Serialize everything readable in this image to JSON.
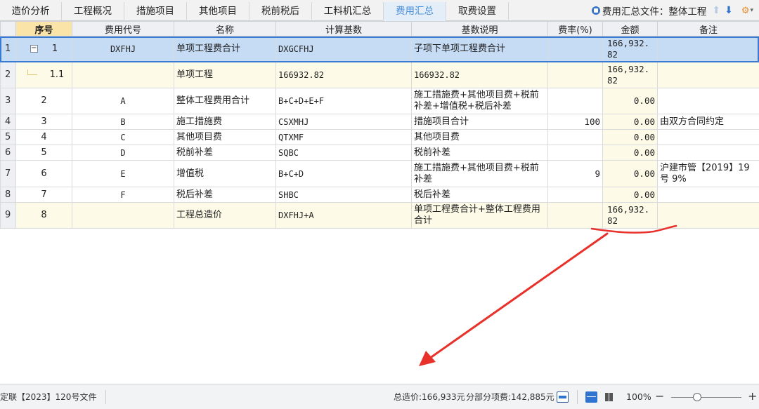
{
  "tabs": [
    {
      "label": "造价分析",
      "active": false
    },
    {
      "label": "工程概况",
      "active": false
    },
    {
      "label": "措施项目",
      "active": false
    },
    {
      "label": "其他项目",
      "active": false
    },
    {
      "label": "税前税后",
      "active": false
    },
    {
      "label": "工料机汇总",
      "active": false
    },
    {
      "label": "费用汇总",
      "active": true
    },
    {
      "label": "取费设置",
      "active": false
    }
  ],
  "header_right": {
    "file_label": "费用汇总文件：整体工程",
    "icons": [
      "file-summary-icon",
      "arrow-up-icon",
      "arrow-down-icon",
      "toolbar-settings-icon"
    ]
  },
  "columns": [
    "序号",
    "费用代号",
    "名称",
    "计算基数",
    "基数说明",
    "费率(%)",
    "金额",
    "备注"
  ],
  "rows": [
    {
      "rownum": "1",
      "seq": "1",
      "code": "DXFHJ",
      "name": "单项工程费合计",
      "base": "DXGCFHJ",
      "desc": "子项下单项工程费合计",
      "rate": "",
      "amount": "166,932.82",
      "note": ""
    },
    {
      "rownum": "2",
      "seq": "1.1",
      "code": "",
      "name": "单项工程",
      "base": "166932.82",
      "desc": "166932.82",
      "rate": "",
      "amount": "166,932.82",
      "note": ""
    },
    {
      "rownum": "3",
      "seq": "2",
      "code": "A",
      "name": "整体工程费用合计",
      "base": "B+C+D+E+F",
      "desc": "施工措施费+其他项目费+税前补差+增值税+税后补差",
      "rate": "",
      "amount": "0.00",
      "note": ""
    },
    {
      "rownum": "4",
      "seq": "3",
      "code": "B",
      "name": "施工措施费",
      "base": "CSXMHJ",
      "desc": "措施项目合计",
      "rate": "100",
      "amount": "0.00",
      "note": "由双方合同约定"
    },
    {
      "rownum": "5",
      "seq": "4",
      "code": "C",
      "name": "其他项目费",
      "base": "QTXMF",
      "desc": "其他项目费",
      "rate": "",
      "amount": "0.00",
      "note": ""
    },
    {
      "rownum": "6",
      "seq": "5",
      "code": "D",
      "name": "税前补差",
      "base": "SQBC",
      "desc": "税前补差",
      "rate": "",
      "amount": "0.00",
      "note": ""
    },
    {
      "rownum": "7",
      "seq": "6",
      "code": "E",
      "name": "增值税",
      "base": "B+C+D",
      "desc": "施工措施费+其他项目费+税前补差",
      "rate": "9",
      "amount": "0.00",
      "note": "沪建市管【2019】19号 9%"
    },
    {
      "rownum": "8",
      "seq": "7",
      "code": "F",
      "name": "税后补差",
      "base": "SHBC",
      "desc": "税后补差",
      "rate": "",
      "amount": "0.00",
      "note": ""
    },
    {
      "rownum": "9",
      "seq": "8",
      "code": "",
      "name": "工程总造价",
      "base": "DXFHJ+A",
      "desc": "单项工程费合计+整体工程费用合计",
      "rate": "",
      "amount": "166,932.82",
      "note": ""
    }
  ],
  "status": {
    "left_text": "定联【2023】120号文件",
    "total_price": "总造价:166,933元",
    "part_fee": "分部分项费:142,885元",
    "zoom": "100%"
  },
  "colors": {
    "accent": "#4a8fd8",
    "selection": "#c6dcf5",
    "header_highlight": "#fbe4a8",
    "amount_bg": "#fdfbe8",
    "annotation_red": "#e8312a"
  }
}
